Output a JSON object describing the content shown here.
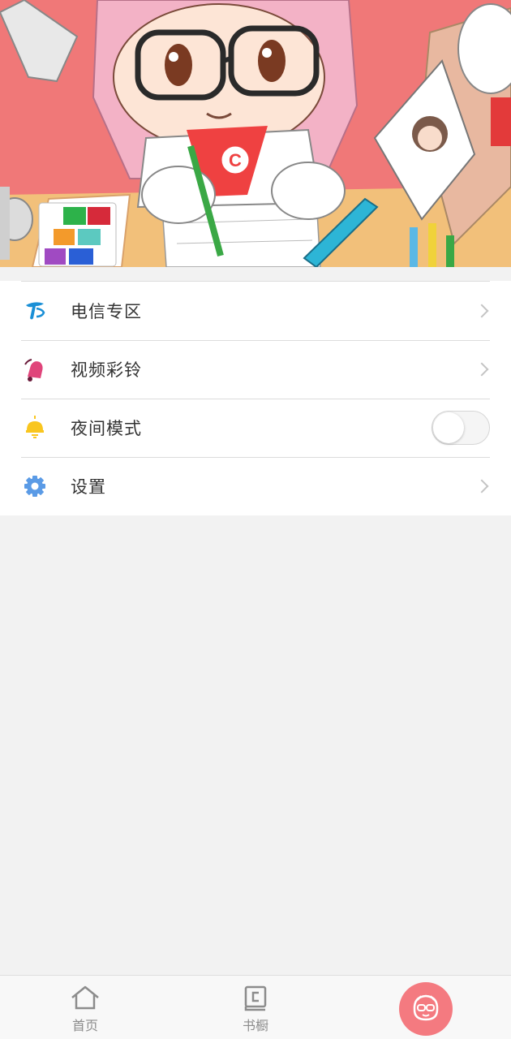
{
  "banner": {
    "badge_letter": "C"
  },
  "menu": {
    "items": [
      {
        "label": "电信专区",
        "icon": "telecom-logo-icon",
        "accessory": "chevron"
      },
      {
        "label": "视频彩铃",
        "icon": "bell-icon",
        "accessory": "chevron"
      },
      {
        "label": "夜间模式",
        "icon": "night-mode-bulb-icon",
        "accessory": "toggle",
        "toggle_on": false
      },
      {
        "label": "设置",
        "icon": "gear-icon",
        "accessory": "chevron"
      }
    ]
  },
  "tabbar": {
    "home_label": "首页",
    "shelf_label": "书橱",
    "me_icon": "mascot-avatar-icon",
    "active_color": "#f47a80"
  },
  "colors": {
    "banner_bg": "#f07878",
    "telecom_blue": "#1a8fd6",
    "bell_pink": "#e0447a",
    "bulb_yellow": "#f9c61f",
    "gear_blue": "#5b9be6"
  }
}
